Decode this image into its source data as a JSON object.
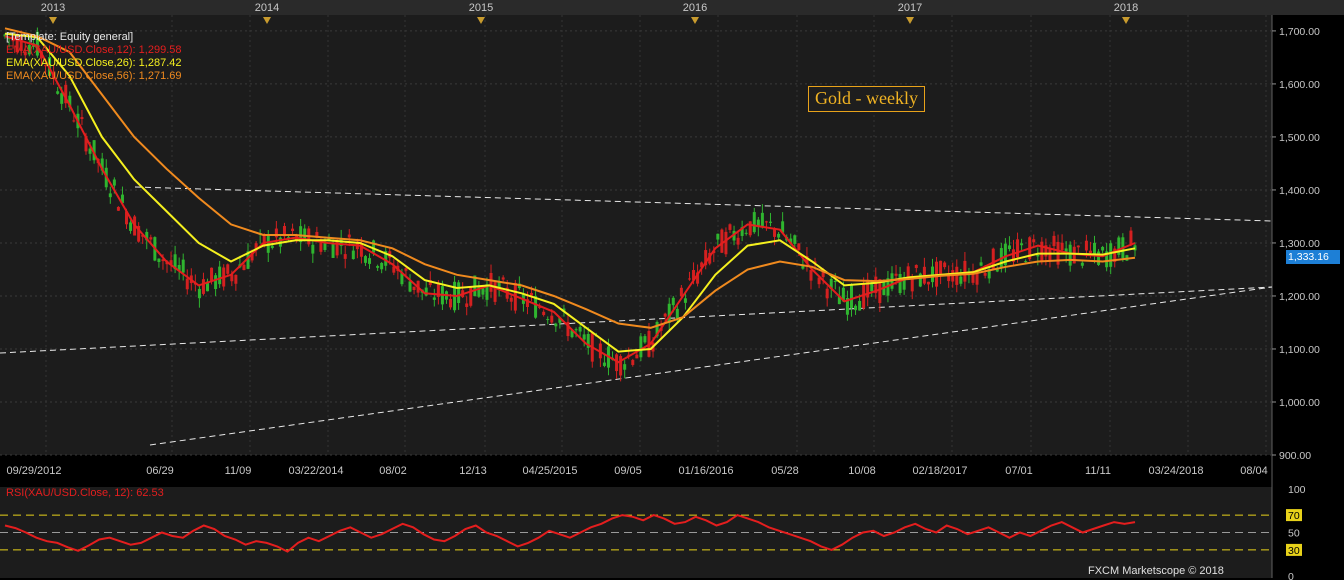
{
  "chart_data": {
    "type": "line",
    "title": "Gold - weekly",
    "template_label": "[Template: Equity general]",
    "price_axis": {
      "ylim": [
        900,
        1730
      ],
      "ticks": [
        "1,700.00",
        "1,600.00",
        "1,500.00",
        "1,400.00",
        "1,300.00",
        "1,200.00",
        "1,100.00",
        "1,000.00",
        "900.00"
      ]
    },
    "years": [
      "2013",
      "2014",
      "2015",
      "2016",
      "2017",
      "2018"
    ],
    "date_ticks": [
      "09/29/2012",
      "06/29",
      "11/09",
      "03/22/2014",
      "08/02",
      "12/13",
      "04/25/2015",
      "09/05",
      "01/16/2016",
      "05/28",
      "10/08",
      "02/18/2017",
      "07/01",
      "11/11",
      "03/24/2018",
      "08/04"
    ],
    "current_price": "1,333.16",
    "series": [
      {
        "name": "EMA(XAU/USD.Close,12)",
        "last": "1,299.58",
        "color": "#e41e1e",
        "values": [
          1690,
          1672,
          1560,
          1440,
          1335,
          1265,
          1220,
          1240,
          1300,
          1310,
          1300,
          1295,
          1260,
          1205,
          1200,
          1220,
          1195,
          1170,
          1110,
          1075,
          1110,
          1200,
          1290,
          1335,
          1325,
          1250,
          1190,
          1210,
          1235,
          1240,
          1245,
          1275,
          1295,
          1280,
          1275,
          1300
        ]
      },
      {
        "name": "EMA(XAU/USD.Close,26)",
        "last": "1,287.42",
        "color": "#f5f01f",
        "values": [
          1695,
          1688,
          1615,
          1500,
          1420,
          1360,
          1300,
          1265,
          1295,
          1305,
          1305,
          1300,
          1275,
          1230,
          1215,
          1220,
          1205,
          1185,
          1140,
          1095,
          1100,
          1160,
          1240,
          1295,
          1305,
          1265,
          1220,
          1225,
          1235,
          1240,
          1245,
          1265,
          1280,
          1280,
          1278,
          1290
        ]
      },
      {
        "name": "EMA(XAU/USD.Close,56)",
        "last": "1,271.69",
        "color": "#f08a1e",
        "values": [
          1705,
          1690,
          1660,
          1580,
          1500,
          1440,
          1385,
          1335,
          1315,
          1315,
          1310,
          1305,
          1290,
          1260,
          1240,
          1230,
          1220,
          1200,
          1175,
          1148,
          1140,
          1160,
          1210,
          1250,
          1265,
          1255,
          1230,
          1228,
          1232,
          1238,
          1242,
          1255,
          1265,
          1268,
          1265,
          1272
        ]
      }
    ],
    "rsi": {
      "label": "RSI(XAU/USD.Close, 12): 62.53",
      "levels": [
        "100",
        "70",
        "50",
        "30",
        "0"
      ],
      "values": [
        58,
        55,
        50,
        44,
        40,
        38,
        33,
        29,
        35,
        42,
        44,
        40,
        36,
        38,
        44,
        50,
        46,
        44,
        52,
        58,
        54,
        46,
        42,
        36,
        40,
        38,
        34,
        28,
        38,
        44,
        40,
        46,
        52,
        56,
        50,
        44,
        48,
        54,
        60,
        56,
        48,
        42,
        40,
        46,
        54,
        58,
        50,
        46,
        40,
        34,
        38,
        44,
        52,
        48,
        44,
        50,
        56,
        60,
        66,
        70,
        68,
        64,
        70,
        66,
        60,
        62,
        68,
        64,
        58,
        62,
        70,
        66,
        62,
        56,
        52,
        48,
        44,
        40,
        34,
        30,
        36,
        44,
        50,
        52,
        46,
        50,
        56,
        60,
        54,
        50,
        58,
        54,
        48,
        52,
        56,
        50,
        44,
        50,
        46,
        52,
        58,
        62,
        56,
        50,
        54,
        58,
        62,
        60,
        62
      ]
    },
    "footer": "FXCM Marketscope © 2018"
  }
}
